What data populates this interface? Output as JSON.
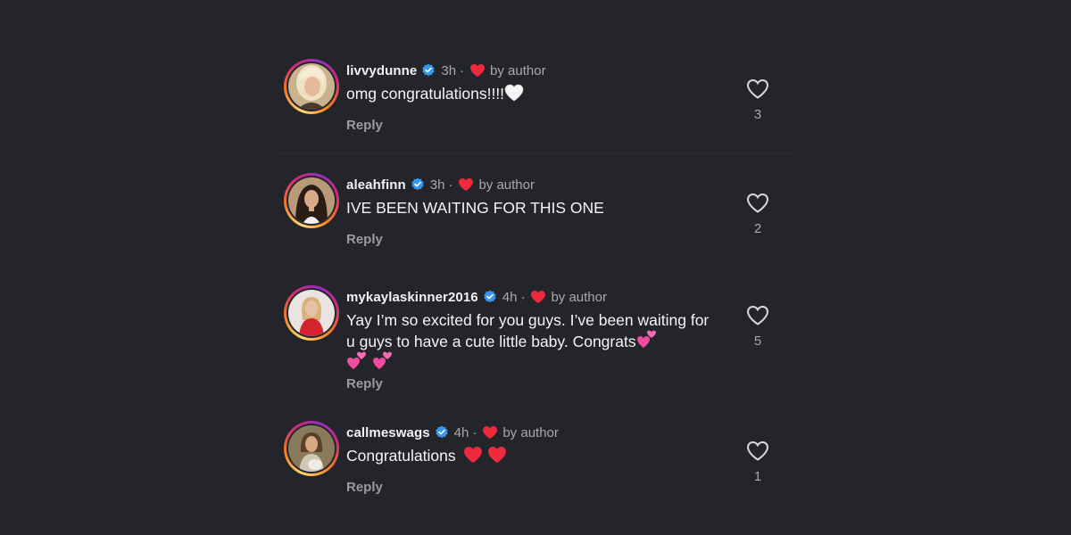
{
  "colors": {
    "background": "#23252b",
    "verified_blue": "#3897f0",
    "liked_red": "#ed2b3d",
    "muted_text": "#a8a8ad"
  },
  "comments": [
    {
      "username": "livvydunne",
      "verified": true,
      "time": "3h",
      "separator": "·",
      "liked_by_author_label": "by author",
      "text": "omg congratulations!!!!",
      "text_emoji": "white-heart",
      "reply_label": "Reply",
      "like_count": "3",
      "avatar_icon": "avatar-photo"
    },
    {
      "username": "aleahfinn",
      "verified": true,
      "time": "3h",
      "separator": "·",
      "liked_by_author_label": "by author",
      "text": "IVE BEEN WAITING FOR THIS ONE",
      "reply_label": "Reply",
      "like_count": "2",
      "avatar_icon": "avatar-photo"
    },
    {
      "username": "mykaylaskinner2016",
      "verified": true,
      "time": "4h",
      "separator": "·",
      "liked_by_author_label": "by author",
      "text": "Yay I’m so excited for you guys. I’ve been waiting for u guys to have a cute little baby. Congrats",
      "text_emoji": "two-hearts x3",
      "reply_label": "Reply",
      "like_count": "5",
      "avatar_icon": "avatar-photo"
    },
    {
      "username": "callmeswags",
      "verified": true,
      "time": "4h",
      "separator": "·",
      "liked_by_author_label": "by author",
      "text": "Congratulations",
      "text_emoji": "red-heart x2",
      "reply_label": "Reply",
      "like_count": "1",
      "avatar_icon": "avatar-photo"
    }
  ]
}
